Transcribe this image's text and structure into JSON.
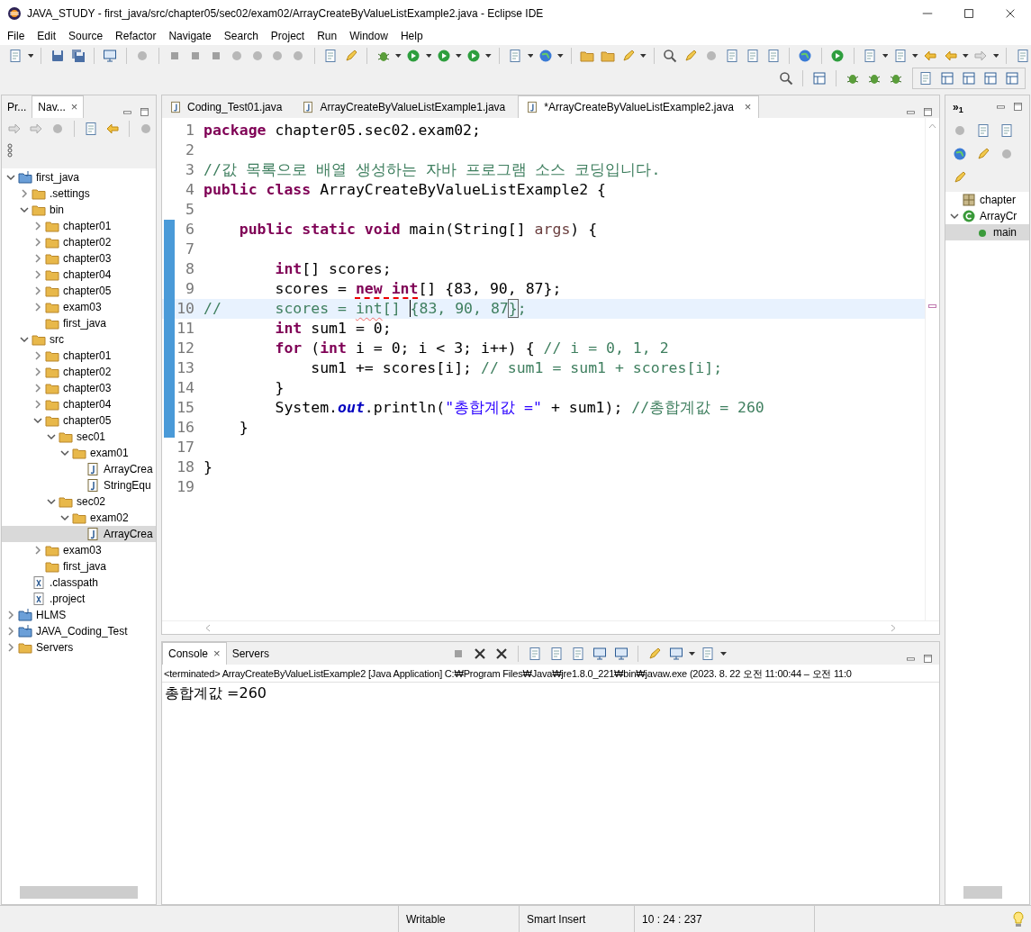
{
  "window": {
    "title": "JAVA_STUDY - first_java/src/chapter05/sec02/exam02/ArrayCreateByValueListExample2.java - Eclipse IDE"
  },
  "menu": [
    "File",
    "Edit",
    "Source",
    "Refactor",
    "Navigate",
    "Search",
    "Project",
    "Run",
    "Window",
    "Help"
  ],
  "left_panel": {
    "tabs": [
      {
        "label": "Pr...",
        "selected": false
      },
      {
        "label": "Nav...",
        "selected": true,
        "close": "×"
      }
    ],
    "tree": [
      {
        "label": "first_java",
        "kind": "project",
        "expanded": true,
        "selected": false,
        "children": [
          {
            "label": ".settings",
            "kind": "folder",
            "expanded": false,
            "selected": false
          },
          {
            "label": "bin",
            "kind": "folder",
            "expanded": true,
            "selected": false,
            "children": [
              {
                "label": "chapter01",
                "kind": "folder",
                "expanded": false,
                "selected": false
              },
              {
                "label": "chapter02",
                "kind": "folder",
                "expanded": false,
                "selected": false
              },
              {
                "label": "chapter03",
                "kind": "folder",
                "expanded": false,
                "selected": false
              },
              {
                "label": "chapter04",
                "kind": "folder",
                "expanded": false,
                "selected": false
              },
              {
                "label": "chapter05",
                "kind": "folder",
                "expanded": false,
                "selected": false
              },
              {
                "label": "exam03",
                "kind": "folder",
                "expanded": false,
                "selected": false
              },
              {
                "label": "first_java",
                "kind": "folder",
                "selected": false
              }
            ]
          },
          {
            "label": "src",
            "kind": "folder",
            "expanded": true,
            "selected": false,
            "children": [
              {
                "label": "chapter01",
                "kind": "folder",
                "expanded": false,
                "selected": false
              },
              {
                "label": "chapter02",
                "kind": "folder",
                "expanded": false,
                "selected": false
              },
              {
                "label": "chapter03",
                "kind": "folder",
                "expanded": false,
                "selected": false
              },
              {
                "label": "chapter04",
                "kind": "folder",
                "expanded": false,
                "selected": false
              },
              {
                "label": "chapter05",
                "kind": "folder",
                "expanded": true,
                "selected": false,
                "children": [
                  {
                    "label": "sec01",
                    "kind": "folder",
                    "expanded": true,
                    "selected": false,
                    "children": [
                      {
                        "label": "exam01",
                        "kind": "folder",
                        "expanded": true,
                        "selected": false,
                        "children": [
                          {
                            "label": "ArrayCrea",
                            "kind": "java",
                            "selected": false
                          },
                          {
                            "label": "StringEqu",
                            "kind": "java",
                            "selected": false
                          }
                        ]
                      }
                    ]
                  },
                  {
                    "label": "sec02",
                    "kind": "folder",
                    "expanded": true,
                    "selected": false,
                    "children": [
                      {
                        "label": "exam02",
                        "kind": "folder",
                        "expanded": true,
                        "selected": false,
                        "children": [
                          {
                            "label": "ArrayCrea",
                            "kind": "java",
                            "selected": true
                          }
                        ]
                      }
                    ]
                  }
                ]
              },
              {
                "label": "exam03",
                "kind": "folder",
                "expanded": false,
                "selected": false
              },
              {
                "label": "first_java",
                "kind": "folder",
                "selected": false
              }
            ]
          },
          {
            "label": ".classpath",
            "kind": "xml",
            "selected": false
          },
          {
            "label": ".project",
            "kind": "xml",
            "selected": false
          }
        ]
      },
      {
        "label": "HLMS",
        "kind": "project",
        "expanded": false,
        "selected": false
      },
      {
        "label": "JAVA_Coding_Test",
        "kind": "project",
        "expanded": false,
        "selected": false
      },
      {
        "label": "Servers",
        "kind": "folder",
        "expanded": false,
        "selected": false
      }
    ]
  },
  "editor": {
    "tabs": [
      {
        "label": "Coding_Test01.java",
        "selected": false
      },
      {
        "label": "ArrayCreateByValueListExample1.java",
        "selected": false
      },
      {
        "label": "*ArrayCreateByValueListExample2.java",
        "selected": true,
        "close": "×"
      }
    ],
    "lines": [
      {
        "number": "1",
        "changed": false,
        "current": false,
        "tokens": [
          {
            "text": "package",
            "kind": "keyword"
          },
          {
            "text": " chapter05.sec02.exam02;",
            "kind": "plain"
          }
        ]
      },
      {
        "number": "2",
        "changed": false,
        "current": false
      },
      {
        "number": "3",
        "changed": false,
        "current": false,
        "tokens": [
          {
            "text": "//값 목록으로 배열 생성하는 자바 프로그램 소스 코딩입니다.",
            "kind": "comment"
          }
        ]
      },
      {
        "number": "4",
        "changed": false,
        "current": false,
        "tokens": [
          {
            "text": "public",
            "kind": "keyword"
          },
          {
            "text": " class",
            "kind": "keyword"
          },
          {
            "text": " ArrayCreateByValueListExample2 {",
            "kind": "plain"
          }
        ]
      },
      {
        "number": "5",
        "changed": false,
        "current": false
      },
      {
        "number": "6",
        "changed": true,
        "current": false,
        "tokens": [
          {
            "text": "    public",
            "kind": "keyword"
          },
          {
            "text": " static",
            "kind": "keyword"
          },
          {
            "text": " void",
            "kind": "keyword"
          },
          {
            "text": " main(String[] ",
            "kind": "plain"
          },
          {
            "text": "args",
            "kind": "param"
          },
          {
            "text": ") {",
            "kind": "plain"
          }
        ]
      },
      {
        "number": "7",
        "changed": true,
        "current": false
      },
      {
        "number": "8",
        "changed": true,
        "current": false,
        "tokens": [
          {
            "text": "        int",
            "kind": "keyword"
          },
          {
            "text": "[] scores;",
            "kind": "plain"
          }
        ]
      },
      {
        "number": "9",
        "changed": true,
        "current": false,
        "tokens": [
          {
            "text": "        scores = ",
            "kind": "plain"
          },
          {
            "text": "new int",
            "kind": "keyword-error"
          },
          {
            "text": "[] {83, 90, 87};",
            "kind": "plain"
          }
        ]
      },
      {
        "number": "10",
        "changed": true,
        "current": true,
        "tokens": [
          {
            "text": "//",
            "kind": "comment"
          },
          {
            "text": "      scores = ",
            "kind": "comment"
          },
          {
            "text": "int",
            "kind": "comment-spelling"
          },
          {
            "text": "[] ",
            "kind": "comment"
          },
          {
            "text": "{83, 90, 87",
            "kind": "comment-caret"
          },
          {
            "text": "}",
            "kind": "comment-bracket"
          },
          {
            "text": ";",
            "kind": "comment"
          }
        ]
      },
      {
        "number": "11",
        "changed": true,
        "current": false,
        "tokens": [
          {
            "text": "        int",
            "kind": "keyword"
          },
          {
            "text": " sum1 = 0;",
            "kind": "plain"
          }
        ]
      },
      {
        "number": "12",
        "changed": true,
        "current": false,
        "tokens": [
          {
            "text": "        for",
            "kind": "keyword"
          },
          {
            "text": " (",
            "kind": "plain"
          },
          {
            "text": "int",
            "kind": "keyword"
          },
          {
            "text": " i = 0; i < 3; i++) { ",
            "kind": "plain"
          },
          {
            "text": "// i = 0, 1, 2",
            "kind": "comment"
          }
        ]
      },
      {
        "number": "13",
        "changed": true,
        "current": false,
        "tokens": [
          {
            "text": "            sum1 += scores[i]; ",
            "kind": "plain"
          },
          {
            "text": "// sum1 = sum1 + scores[i];",
            "kind": "comment"
          }
        ]
      },
      {
        "number": "14",
        "changed": true,
        "current": false,
        "tokens": [
          {
            "text": "        }",
            "kind": "plain"
          }
        ]
      },
      {
        "number": "15",
        "changed": true,
        "current": false,
        "tokens": [
          {
            "text": "        System.",
            "kind": "plain"
          },
          {
            "text": "out",
            "kind": "field"
          },
          {
            "text": ".println(",
            "kind": "plain"
          },
          {
            "text": "\"총합계값 =\"",
            "kind": "string"
          },
          {
            "text": " + sum1); ",
            "kind": "plain"
          },
          {
            "text": "//총합계값 = 260",
            "kind": "comment"
          }
        ]
      },
      {
        "number": "16",
        "changed": true,
        "current": false,
        "tokens": [
          {
            "text": "    }",
            "kind": "plain"
          }
        ]
      },
      {
        "number": "17",
        "changed": false,
        "current": false
      },
      {
        "number": "18",
        "changed": false,
        "current": false,
        "tokens": [
          {
            "text": "}",
            "kind": "plain"
          }
        ]
      },
      {
        "number": "19",
        "changed": false,
        "current": false
      }
    ]
  },
  "console": {
    "tabs": [
      {
        "label": "Console",
        "selected": true,
        "close": "×"
      },
      {
        "label": "Servers",
        "selected": false
      }
    ],
    "header": "<terminated> ArrayCreateByValueListExample2 [Java Application] C:₩Program Files₩Java₩jre1.8.0_221₩bin₩javaw.exe  (2023. 8. 22 오전 11:00:44 – 오전 11:0",
    "output": "총합계값 =260"
  },
  "outline": {
    "tab": "»$_{1}$",
    "items": [
      {
        "label": "chapter",
        "kind": "package",
        "selected": false
      },
      {
        "label": "ArrayCr",
        "kind": "class",
        "expanded": true,
        "selected": false,
        "children": [
          {
            "label": "main",
            "kind": "method",
            "selected": true
          }
        ]
      }
    ]
  },
  "status_bar": [
    "Writable",
    "Smart Insert",
    "10 : 24 : 237"
  ]
}
